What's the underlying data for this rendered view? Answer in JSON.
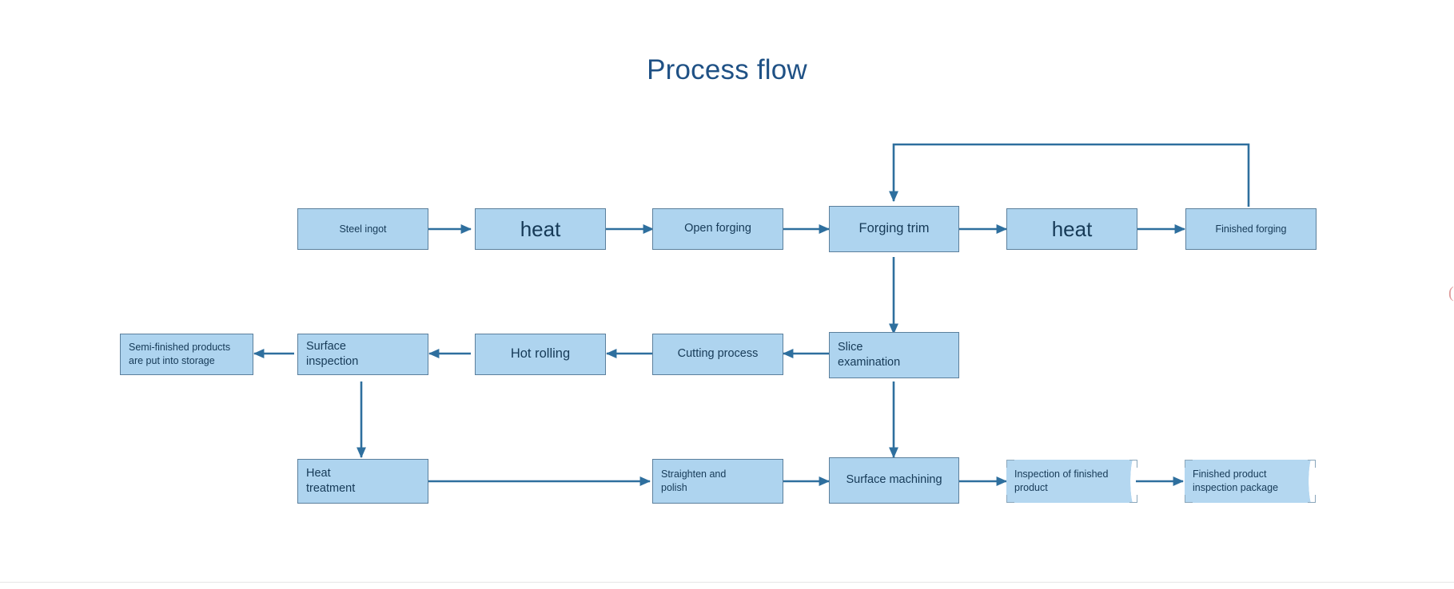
{
  "title": "Process flow",
  "colors": {
    "title": "#1f5185",
    "node_fill": "#aed4ef",
    "node_border": "#5b7f9c",
    "connector": "#2e6f9e",
    "text": "#163a57"
  },
  "edge_glyph": "(",
  "nodes": {
    "steel_ingot": "Steel ingot",
    "heat_1": "heat",
    "open_forging": "Open forging",
    "forging_trim": "Forging trim",
    "heat_2": "heat",
    "finished_forging": "Finished forging",
    "semi_finished_storage": "Semi-finished products\nare put into storage",
    "surface_inspection": "Surface\ninspection",
    "hot_rolling": "Hot rolling",
    "cutting_process": "Cutting process",
    "slice_examination": "Slice\nexamination",
    "heat_treatment": "Heat\ntreatment",
    "straighten_polish": "Straighten and\npolish",
    "surface_machining": "Surface machining",
    "inspection_finished_product": "Inspection of finished\nproduct",
    "finished_product_package": "Finished product\ninspection package"
  },
  "flow": {
    "row1": [
      "Steel ingot",
      "heat",
      "Open forging",
      "Forging trim",
      "heat",
      "Finished forging"
    ],
    "row2": [
      "Slice examination",
      "Cutting process",
      "Hot rolling",
      "Surface inspection",
      "Semi-finished products are put into storage"
    ],
    "row3": [
      "Heat treatment",
      "Straighten and polish",
      "Surface machining",
      "Inspection of finished product",
      "Finished product inspection package"
    ],
    "edges": [
      "Steel ingot -> heat",
      "heat -> Open forging",
      "Open forging -> Forging trim",
      "Forging trim -> heat",
      "heat -> Finished forging",
      "Finished forging -> Forging trim (feedback loop)",
      "Forging trim -> Slice examination",
      "Slice examination -> Cutting process",
      "Cutting process -> Hot rolling",
      "Hot rolling -> Surface inspection",
      "Surface inspection -> Semi-finished products are put into storage",
      "Surface inspection -> Heat treatment",
      "Slice examination -> Surface machining",
      "Heat treatment -> Straighten and polish",
      "Straighten and polish -> Surface machining",
      "Surface machining -> Inspection of finished product",
      "Inspection of finished product -> Finished product inspection package"
    ]
  }
}
